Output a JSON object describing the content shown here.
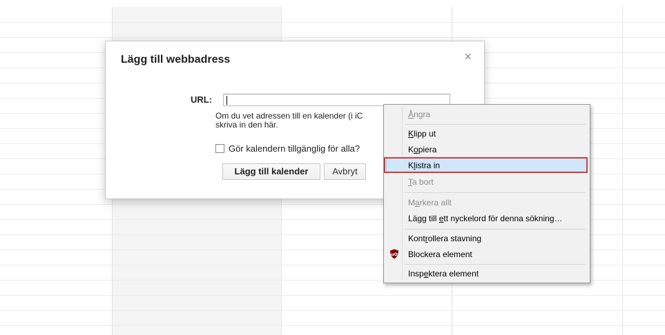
{
  "dialog": {
    "title": "Lägg till webbadress",
    "close_symbol": "×",
    "url_label": "URL:",
    "url_value": "",
    "help_text": "Om du vet adressen till en kalender (i iC… skriva in den här.",
    "help_line1": "Om du vet adressen till en kalender (i iC",
    "help_line2": "skriva in den här.",
    "public_checkbox_label": "Gör kalendern tillgänglig för alla?",
    "public_checkbox_checked": false,
    "add_button": "Lägg till kalender",
    "cancel_button": "Avbryt"
  },
  "context_menu": {
    "items": [
      {
        "pre": "",
        "key": "Å",
        "post": "ngra",
        "disabled": true
      },
      {
        "pre": "",
        "key": "K",
        "post": "lipp ut",
        "disabled": false
      },
      {
        "pre": "K",
        "key": "o",
        "post": "piera",
        "disabled": false
      },
      {
        "pre": "K",
        "key": "l",
        "post": "istra in",
        "disabled": false,
        "highlighted": true
      },
      {
        "pre": "",
        "key": "T",
        "post": "a bort",
        "disabled": true
      },
      {
        "pre": "M",
        "key": "a",
        "post": "rkera allt",
        "disabled": true
      },
      {
        "pre": "Lägg till ",
        "key": "e",
        "post": "tt nyckelord för denna sökning…",
        "disabled": false
      },
      {
        "pre": "Kont",
        "key": "r",
        "post": "ollera stavning",
        "disabled": false
      },
      {
        "pre": "Blockera element",
        "key": "",
        "post": "",
        "disabled": false,
        "icon": "ublock-origin-icon"
      },
      {
        "pre": "Insp",
        "key": "e",
        "post": "ktera element",
        "disabled": false
      }
    ]
  },
  "colors": {
    "highlight_bg": "#cfe6fb",
    "annotation_box": "#d13c3c",
    "ublock_red": "#800000"
  }
}
